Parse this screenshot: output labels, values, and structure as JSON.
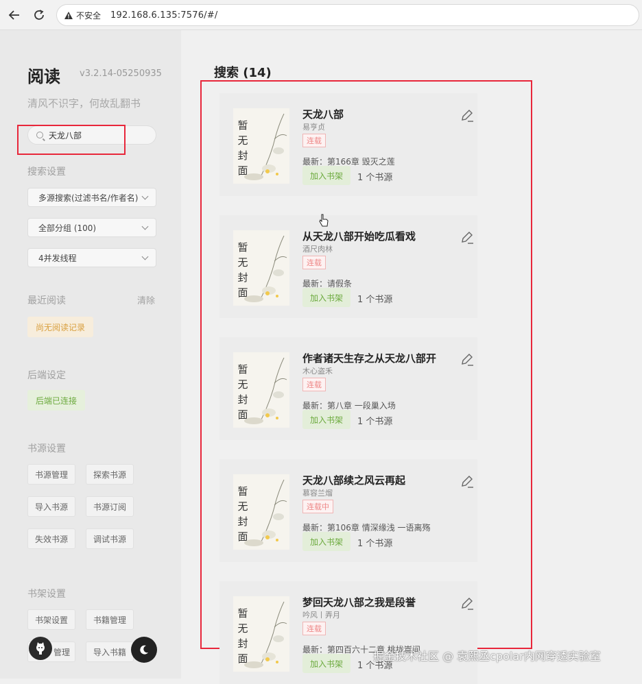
{
  "browser": {
    "security_label": "不安全",
    "url": "192.168.6.135:7576/#/"
  },
  "sidebar": {
    "app_name": "阅读",
    "version": "v3.2.14-05250935",
    "slogan": "清风不识字，何故乱翻书",
    "search_value": "天龙八部",
    "search_settings_label": "搜索设置",
    "search_mode": "多源搜索(过滤书名/作者名)",
    "group": "全部分组 (100)",
    "threads": "4并发线程",
    "recent_label": "最近阅读",
    "clear_label": "清除",
    "no_history": "尚无阅读记录",
    "backend_label": "后端设定",
    "backend_status": "后端已连接",
    "source_settings_label": "书源设置",
    "source_buttons": [
      "书源管理",
      "探索书源",
      "导入书源",
      "书源订阅",
      "失效书源",
      "调试书源"
    ],
    "shelf_settings_label": "书架设置",
    "shelf_buttons": [
      "书架设置",
      "书籍管理",
      "管理",
      "导入书籍"
    ]
  },
  "main": {
    "title": "搜索 (14)",
    "add_label": "加入书架",
    "cover_text": "暂无封面",
    "books": [
      {
        "title": "天龙八部",
        "author": "易亨贞",
        "status": "连载",
        "latest": "最新：第166章 毁灭之莲",
        "sources": "1 个书源"
      },
      {
        "title": "从天龙八部开始吃瓜看戏",
        "author": "酒尺肉林",
        "status": "连载",
        "latest": "最新：请假条",
        "sources": "1 个书源"
      },
      {
        "title": "作者诸天生存之从天龙八部开",
        "author": "木心盗禾",
        "status": "连载",
        "latest": "最新：第八章 一段巢入场",
        "sources": "1 个书源"
      },
      {
        "title": "天龙八部续之风云再起",
        "author": "慕容兰熘",
        "status": "连载中",
        "latest": "最新：第106章 情深缘浅 一语离殇",
        "sources": "1 个书源"
      },
      {
        "title": "梦回天龙八部之我是段誉",
        "author": "吟风丨弄月",
        "status": "连载",
        "latest": "最新：第四百六十二章 桃拢嵩间",
        "sources": "1 个书源"
      }
    ]
  },
  "watermark": "掘金技术社区 @ 袁熙丞cpolar内网穿透实验室"
}
